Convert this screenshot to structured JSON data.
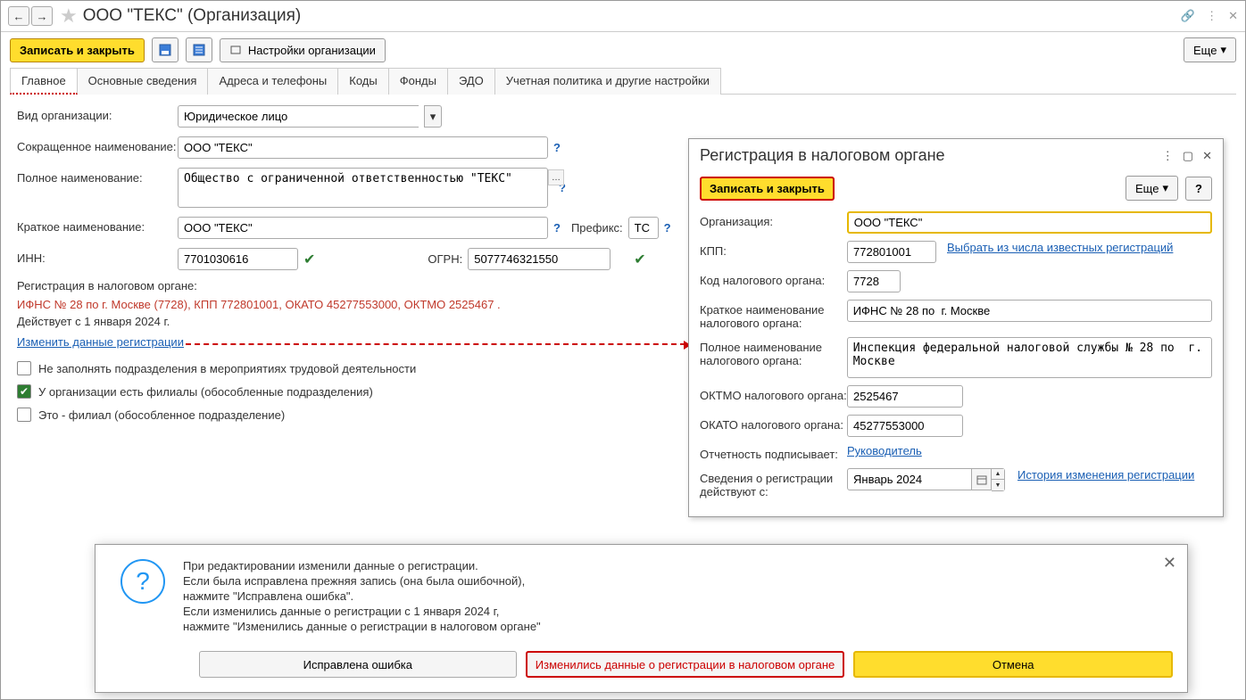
{
  "header": {
    "title": "ООО \"ТЕКС\" (Организация)"
  },
  "toolbar": {
    "save_close": "Записать и закрыть",
    "settings": "Настройки организации",
    "more": "Еще"
  },
  "tabs": [
    "Главное",
    "Основные сведения",
    "Адреса и телефоны",
    "Коды",
    "Фонды",
    "ЭДО",
    "Учетная политика и другие настройки"
  ],
  "form": {
    "org_type_lbl": "Вид организации:",
    "org_type": "Юридическое лицо",
    "short_name_lbl": "Сокращенное наименование:",
    "short_name": "ООО \"ТЕКС\"",
    "full_name_lbl": "Полное наименование:",
    "full_name": "Общество с ограниченной ответственностью \"ТЕКС\"",
    "brief_name_lbl": "Краткое наименование:",
    "brief_name": "ООО \"ТЕКС\"",
    "prefix_lbl": "Префикс:",
    "prefix": "ТС",
    "inn_lbl": "ИНН:",
    "inn": "7701030616",
    "ogrn_lbl": "ОГРН:",
    "ogrn": "5077746321550",
    "reg_section": "Регистрация в налоговом органе:",
    "reg_info": "ИФНС № 28 по  г. Москве (7728), КПП 772801001, ОКАТО 45277553000, ОКТМО 2525467   .",
    "reg_valid": "Действует с 1 января 2024 г.",
    "change_link": "Изменить данные регистрации",
    "chk1": "Не заполнять подразделения в мероприятиях трудовой деятельности",
    "chk2": "У организации есть филиалы (обособленные подразделения)",
    "chk3": "Это - филиал (обособленное подразделение)"
  },
  "panel": {
    "title": "Регистрация в налоговом органе",
    "save_close": "Записать и закрыть",
    "more": "Еще",
    "org_lbl": "Организация:",
    "org": "ООО \"ТЕКС\"",
    "kpp_lbl": "КПП:",
    "kpp": "772801001",
    "known_link": "Выбрать из числа известных регистраций",
    "code_lbl": "Код налогового органа:",
    "code": "7728",
    "short_tax_lbl": "Краткое наименование налогового органа:",
    "short_tax": "ИФНС № 28 по  г. Москве",
    "full_tax_lbl": "Полное наименование налогового органа:",
    "full_tax": "Инспекция федеральной налоговой службы № 28 по  г. Москве",
    "oktmo_lbl": "ОКТМО налогового органа:",
    "oktmo": "2525467",
    "okato_lbl": "ОКАТО налогового органа:",
    "okato": "45277553000",
    "signer_lbl": "Отчетность подписывает:",
    "signer": "Руководитель",
    "valid_lbl": "Сведения о регистрации действуют с:",
    "valid": "Январь 2024",
    "history_link": "История изменения регистрации"
  },
  "dialog": {
    "l1": "При редактировании изменили данные о регистрации.",
    "l2": "Если была исправлена прежняя запись (она была ошибочной),",
    "l3": "нажмите \"Исправлена ошибка\".",
    "l4": "Если изменились данные о регистрации с 1 января 2024 г,",
    "l5": "нажмите \"Изменились данные о регистрации в налоговом органе\"",
    "b1": "Исправлена ошибка",
    "b2": "Изменились данные о регистрации в налоговом органе",
    "b3": "Отмена"
  }
}
